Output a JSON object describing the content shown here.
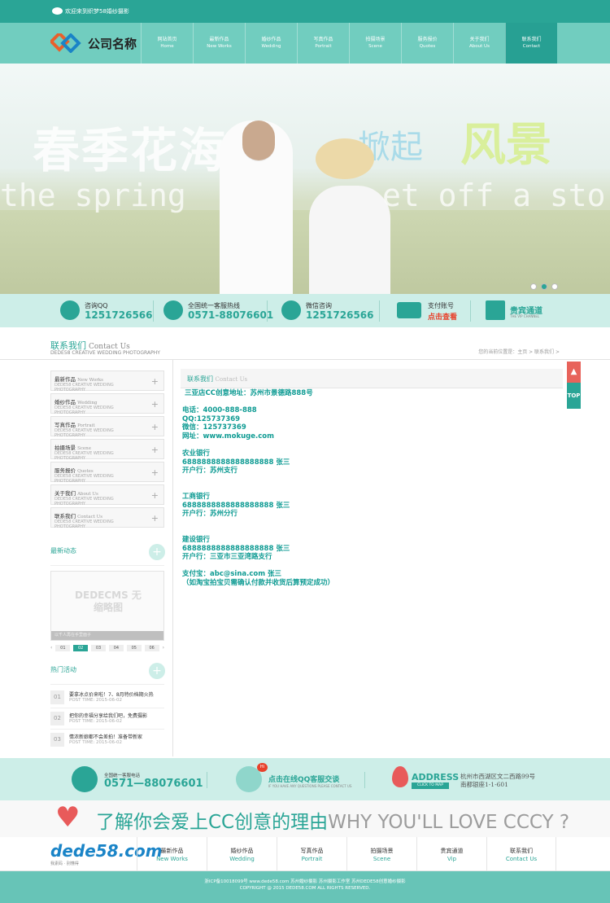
{
  "topbar": {
    "welcome": "欢迎来到织梦58婚纱摄影"
  },
  "logo": {
    "name": "公司名称"
  },
  "nav": [
    {
      "cn": "网站首页",
      "en": "Home"
    },
    {
      "cn": "最新作品",
      "en": "New Works"
    },
    {
      "cn": "婚纱作品",
      "en": "Wedding"
    },
    {
      "cn": "写真作品",
      "en": "Portrait"
    },
    {
      "cn": "拍摄场景",
      "en": "Scene"
    },
    {
      "cn": "服务报价",
      "en": "Quotes"
    },
    {
      "cn": "关于我们",
      "en": "About Us"
    },
    {
      "cn": "联系我们",
      "en": "Contact"
    }
  ],
  "banner": {
    "title_a": "春季花海",
    "title_b": "掀起",
    "title_c": "风景",
    "en_a": "the spring",
    "en_b": "et off a storm"
  },
  "services": [
    {
      "label": "咨询QQ",
      "value": "1251726566"
    },
    {
      "label": "全国统一客服热线",
      "value": "0571-88076601"
    },
    {
      "label": "微信咨询",
      "value": "1251726566"
    },
    {
      "label": "支付账号",
      "value": "点击查看"
    },
    {
      "label": "贵宾通道",
      "sub": "THE VIP CHANNEL"
    }
  ],
  "page": {
    "title": "联系我们",
    "title_en": "Contact Us",
    "subtitle": "DEDE58 CREATIVE WEDDING PHOTOGRAPHY",
    "breadcrumb": "您的当前位置是：主页 > 联系我们 >"
  },
  "sidebar": {
    "items": [
      {
        "cn": "最新作品",
        "en": "New Works",
        "desc": "DEDE58 CREATIVE WEDDING PHOTOGRAPHY"
      },
      {
        "cn": "婚纱作品",
        "en": "Wedding",
        "desc": "DEDE58 CREATIVE WEDDING PHOTOGRAPHY"
      },
      {
        "cn": "写真作品",
        "en": "Portrait",
        "desc": "DEDE58 CREATIVE WEDDING PHOTOGRAPHY"
      },
      {
        "cn": "拍摄场景",
        "en": "Scene",
        "desc": "DEDE58 CREATIVE WEDDING PHOTOGRAPHY"
      },
      {
        "cn": "服务报价",
        "en": "Quotes",
        "desc": "DEDE58 CREATIVE WEDDING PHOTOGRAPHY"
      },
      {
        "cn": "关于我们",
        "en": "About Us",
        "desc": "DEDE58 CREATIVE WEDDING PHOTOGRAPHY"
      },
      {
        "cn": "联系我们",
        "en": "Contact Us",
        "desc": "DEDE58 CREATIVE WEDDING PHOTOGRAPHY"
      }
    ],
    "news_title": "最新动态",
    "thumb_text": "DEDECMS 无缩略图",
    "thumb_caption": "以千人再在手里面子",
    "pages": [
      "01",
      "02",
      "03",
      "04",
      "05",
      "06"
    ],
    "hot_title": "热门活动",
    "activities": [
      {
        "num": "01",
        "title": "要拿冰点价来啦！7、8月特价档期火热",
        "date": "POST TIME: 2015-06-02"
      },
      {
        "num": "02",
        "title": "把你的幸福分享给我们吧，免费摄影",
        "date": "POST TIME: 2015-06-02"
      },
      {
        "num": "03",
        "title": "情浓新娘都不会差拍！准备带新家",
        "date": "POST TIME: 2015-06-02"
      }
    ]
  },
  "main": {
    "header_cn": "联系我们",
    "header_en": "Contact Us",
    "lines": [
      "三亚店CC创意地址：苏州市景德路888号",
      "",
      "电话：4000-888-888",
      "QQ:125737369",
      "微信：125737369",
      "网址：www.mokuge.com",
      "",
      "农业银行",
      "6888888888888888888 张三",
      "开户行：苏州支行",
      "",
      "",
      "工商银行",
      "6888888888888888888 张三",
      "开户行：苏州分行",
      "",
      "",
      "建设银行",
      "6888888888888888888 张三",
      "开户行：三亚市三亚湾路支行",
      "",
      "支付宝：abc@sina.com 张三",
      "（如淘宝拍宝贝需确认付款并收货后算预定成功）"
    ]
  },
  "totop": {
    "label": "TOP"
  },
  "footer": {
    "hotline_label": "全国统一客服电话",
    "hotline": "0571—88076601",
    "qq_badge": "Hi",
    "qq_text": "点击在线QQ客服交谈",
    "qq_sub": "IF YOU HAVE ANY QUESTIONS PLEASE CONTACT US",
    "address_title": "ADDRESS",
    "address_btn": "CLICK TO MAP",
    "address_line1": "杭州市西湖区文二西路99号",
    "address_line2": "南都银座1-1-601",
    "slogan_cn": "了解你会爱上CC创意的理由",
    "slogan_en": "WHY YOU'LL LOVE CCCY ?",
    "logo": "dede58.com",
    "logo_sub": "我素码 · 别懂得",
    "nav": [
      {
        "cn": "最新作品",
        "en": "New Works"
      },
      {
        "cn": "婚纱作品",
        "en": "Wedding"
      },
      {
        "cn": "写真作品",
        "en": "Portrait"
      },
      {
        "cn": "拍摄场景",
        "en": "Scene"
      },
      {
        "cn": "贵宾通道",
        "en": "Vip"
      },
      {
        "cn": "联系我们",
        "en": "Contact Us"
      }
    ],
    "copy1": "浙ICP备10018099号 www.dede58.com 苏州婚纱摄影 苏州摄影工作室 苏州DEDE58创意婚纱摄影",
    "copy2": "COPYRIGHT @ 2015 DEDE58.COM ALL RIGHTS RESERVED."
  },
  "colors": {
    "accent": "#2aa596",
    "light": "#cdeee8",
    "header": "#71cdbf",
    "red": "#e8412b"
  }
}
